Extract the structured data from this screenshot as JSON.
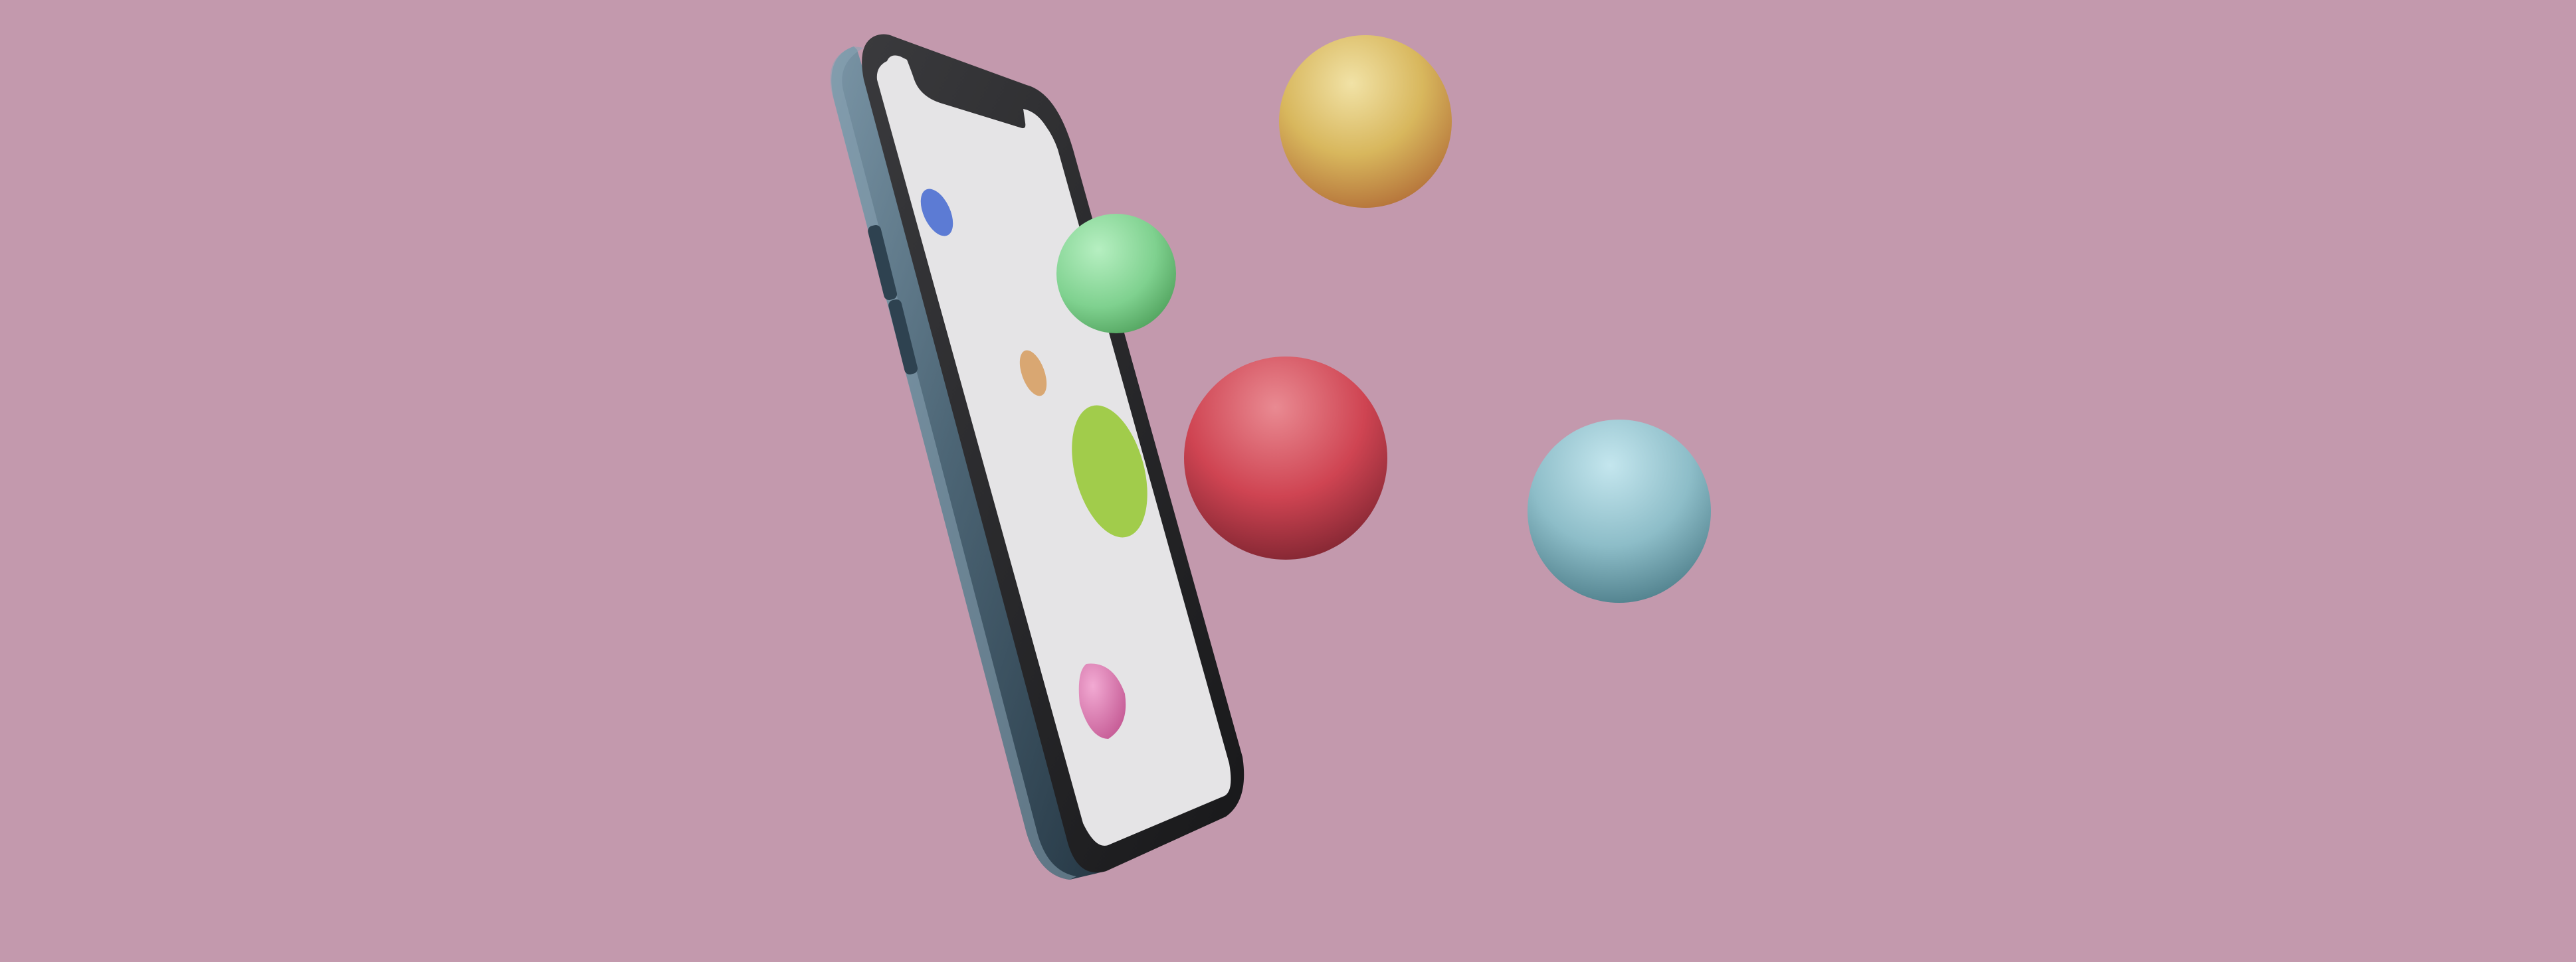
{
  "scene": {
    "background_color": "#c399ad",
    "subject": "phone-mockup",
    "phone": {
      "frame_color": "#4a6372",
      "bezel_color": "#2a2a2d",
      "screen_color": "#e5e4e6"
    },
    "screen_blobs": [
      {
        "name": "blue-blob",
        "color": "#5c7bd4"
      },
      {
        "name": "orange-blob",
        "color": "#d9a772"
      },
      {
        "name": "lime-blob",
        "color": "#a1cc4b"
      },
      {
        "name": "pink-blob",
        "color": "#e28dbf"
      }
    ],
    "spheres": [
      {
        "name": "yellow-sphere",
        "color": "#d8b75d"
      },
      {
        "name": "green-sphere",
        "color": "#7fd18f"
      },
      {
        "name": "red-sphere",
        "color": "#cf4452"
      },
      {
        "name": "blue-sphere",
        "color": "#8dbdc8"
      }
    ]
  }
}
